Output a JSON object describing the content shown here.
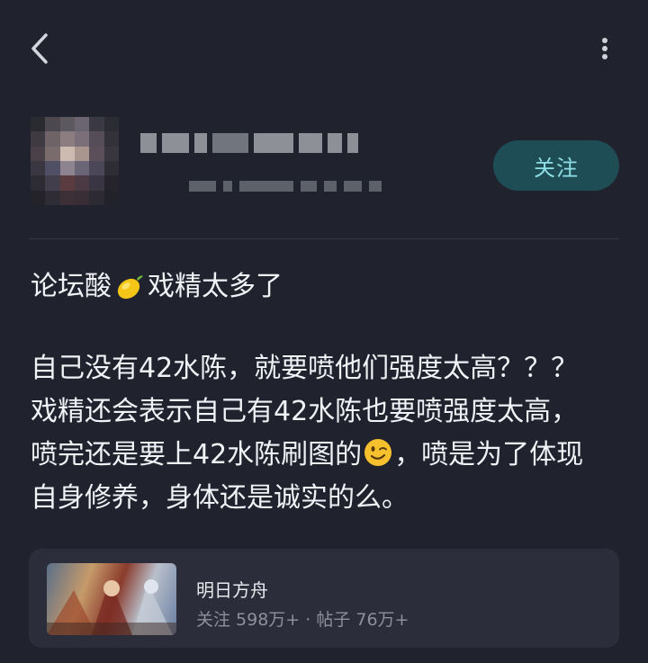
{
  "header": {
    "back_icon": "chevron-left-icon",
    "more_icon": "more-vertical-icon"
  },
  "author": {
    "follow_label": "关注"
  },
  "post": {
    "title_prefix": "论坛酸",
    "title_emoji": "lemon-icon",
    "title_suffix": "戏精太多了",
    "body_lines": [
      "自己没有42水陈，就要喷他们强度太高？？？",
      "戏精还会表示自己有42水陈也要喷强度太高，",
      "喷完还是要上42水陈刷图的",
      "，喷是为了体现",
      "自身修养，身体还是诚实的么。"
    ],
    "body_emoji": "wink-icon"
  },
  "forum": {
    "name": "明日方舟",
    "stats": "关注 598万+ · 帖子 76万+"
  },
  "colors": {
    "background": "#20232e",
    "card": "#2b2e3a",
    "follow_bg": "#1f4d55",
    "follow_text": "#8fe0e6"
  }
}
